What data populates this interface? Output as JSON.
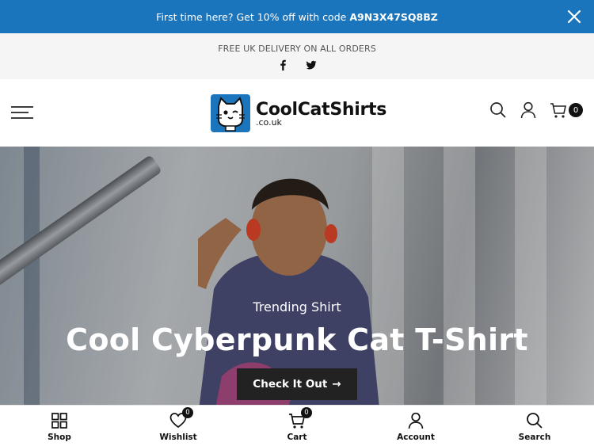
{
  "promo": {
    "text": "First time here? Get 10% off with code",
    "code": "A9N3X47SQ8BZ"
  },
  "topbar": {
    "delivery_text": "FREE UK DELIVERY ON ALL ORDERS",
    "social": [
      "facebook-icon",
      "twitter-icon"
    ]
  },
  "header": {
    "logo_name": "CoolCatShirts",
    "logo_sub": ".co.uk",
    "cart_count": "0"
  },
  "hero": {
    "eyebrow": "Trending Shirt",
    "title": "Cool Cyberpunk Cat T-Shirt",
    "cta_label": "Check It Out",
    "cta_arrow": "→"
  },
  "bottom_nav": {
    "shop": "Shop",
    "wishlist": "Wishlist",
    "wishlist_count": "0",
    "cart": "Cart",
    "cart_count": "0",
    "account": "Account",
    "search": "Search"
  },
  "colors": {
    "promo_bg": "#1b75bc",
    "logo_blue": "#1b75bc",
    "cta_bg": "#222222"
  }
}
